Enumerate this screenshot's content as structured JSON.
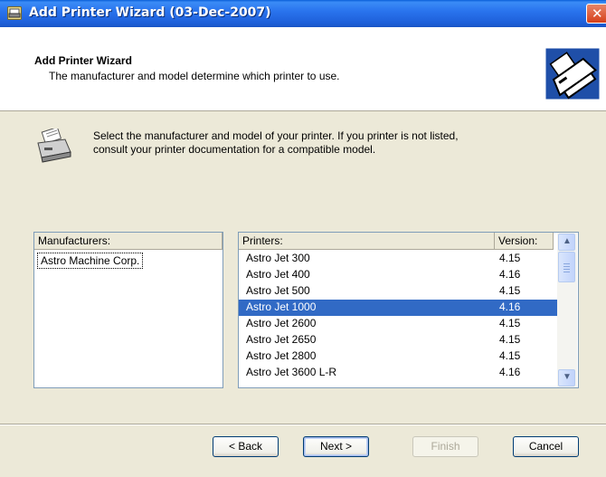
{
  "window": {
    "title": "Add Printer Wizard (03-Dec-2007)",
    "close_label": "✕"
  },
  "header": {
    "title": "Add Printer Wizard",
    "subtitle": "The manufacturer and model determine which printer to use."
  },
  "instructions": {
    "line1": "Select the manufacturer and model of your printer. If you printer is not listed,",
    "line2": "consult your printer documentation for a compatible model."
  },
  "manufacturers": {
    "header": "Manufacturers:",
    "items": [
      "Astro Machine Corp."
    ]
  },
  "printers": {
    "header_name": "Printers:",
    "header_version": "Version:",
    "rows": [
      {
        "name": "Astro Jet 300",
        "version": "4.15",
        "selected": false
      },
      {
        "name": "Astro Jet 400",
        "version": "4.16",
        "selected": false
      },
      {
        "name": "Astro Jet 500",
        "version": "4.15",
        "selected": false
      },
      {
        "name": "Astro Jet 1000",
        "version": "4.16",
        "selected": true
      },
      {
        "name": "Astro Jet 2600",
        "version": "4.15",
        "selected": false
      },
      {
        "name": "Astro Jet 2650",
        "version": "4.15",
        "selected": false
      },
      {
        "name": "Astro Jet 2800",
        "version": "4.15",
        "selected": false
      },
      {
        "name": "Astro Jet 3600 L-R",
        "version": "4.16",
        "selected": false
      }
    ]
  },
  "buttons": {
    "back": "< Back",
    "next": "Next >",
    "finish": "Finish",
    "cancel": "Cancel"
  },
  "colors": {
    "titlebar": "#2a74ee",
    "selection": "#316ac5",
    "dialog_bg": "#ece9d8"
  },
  "icons": {
    "title": "printer-wizard-icon",
    "header": "printer-icon",
    "instruction": "printer-icon"
  }
}
